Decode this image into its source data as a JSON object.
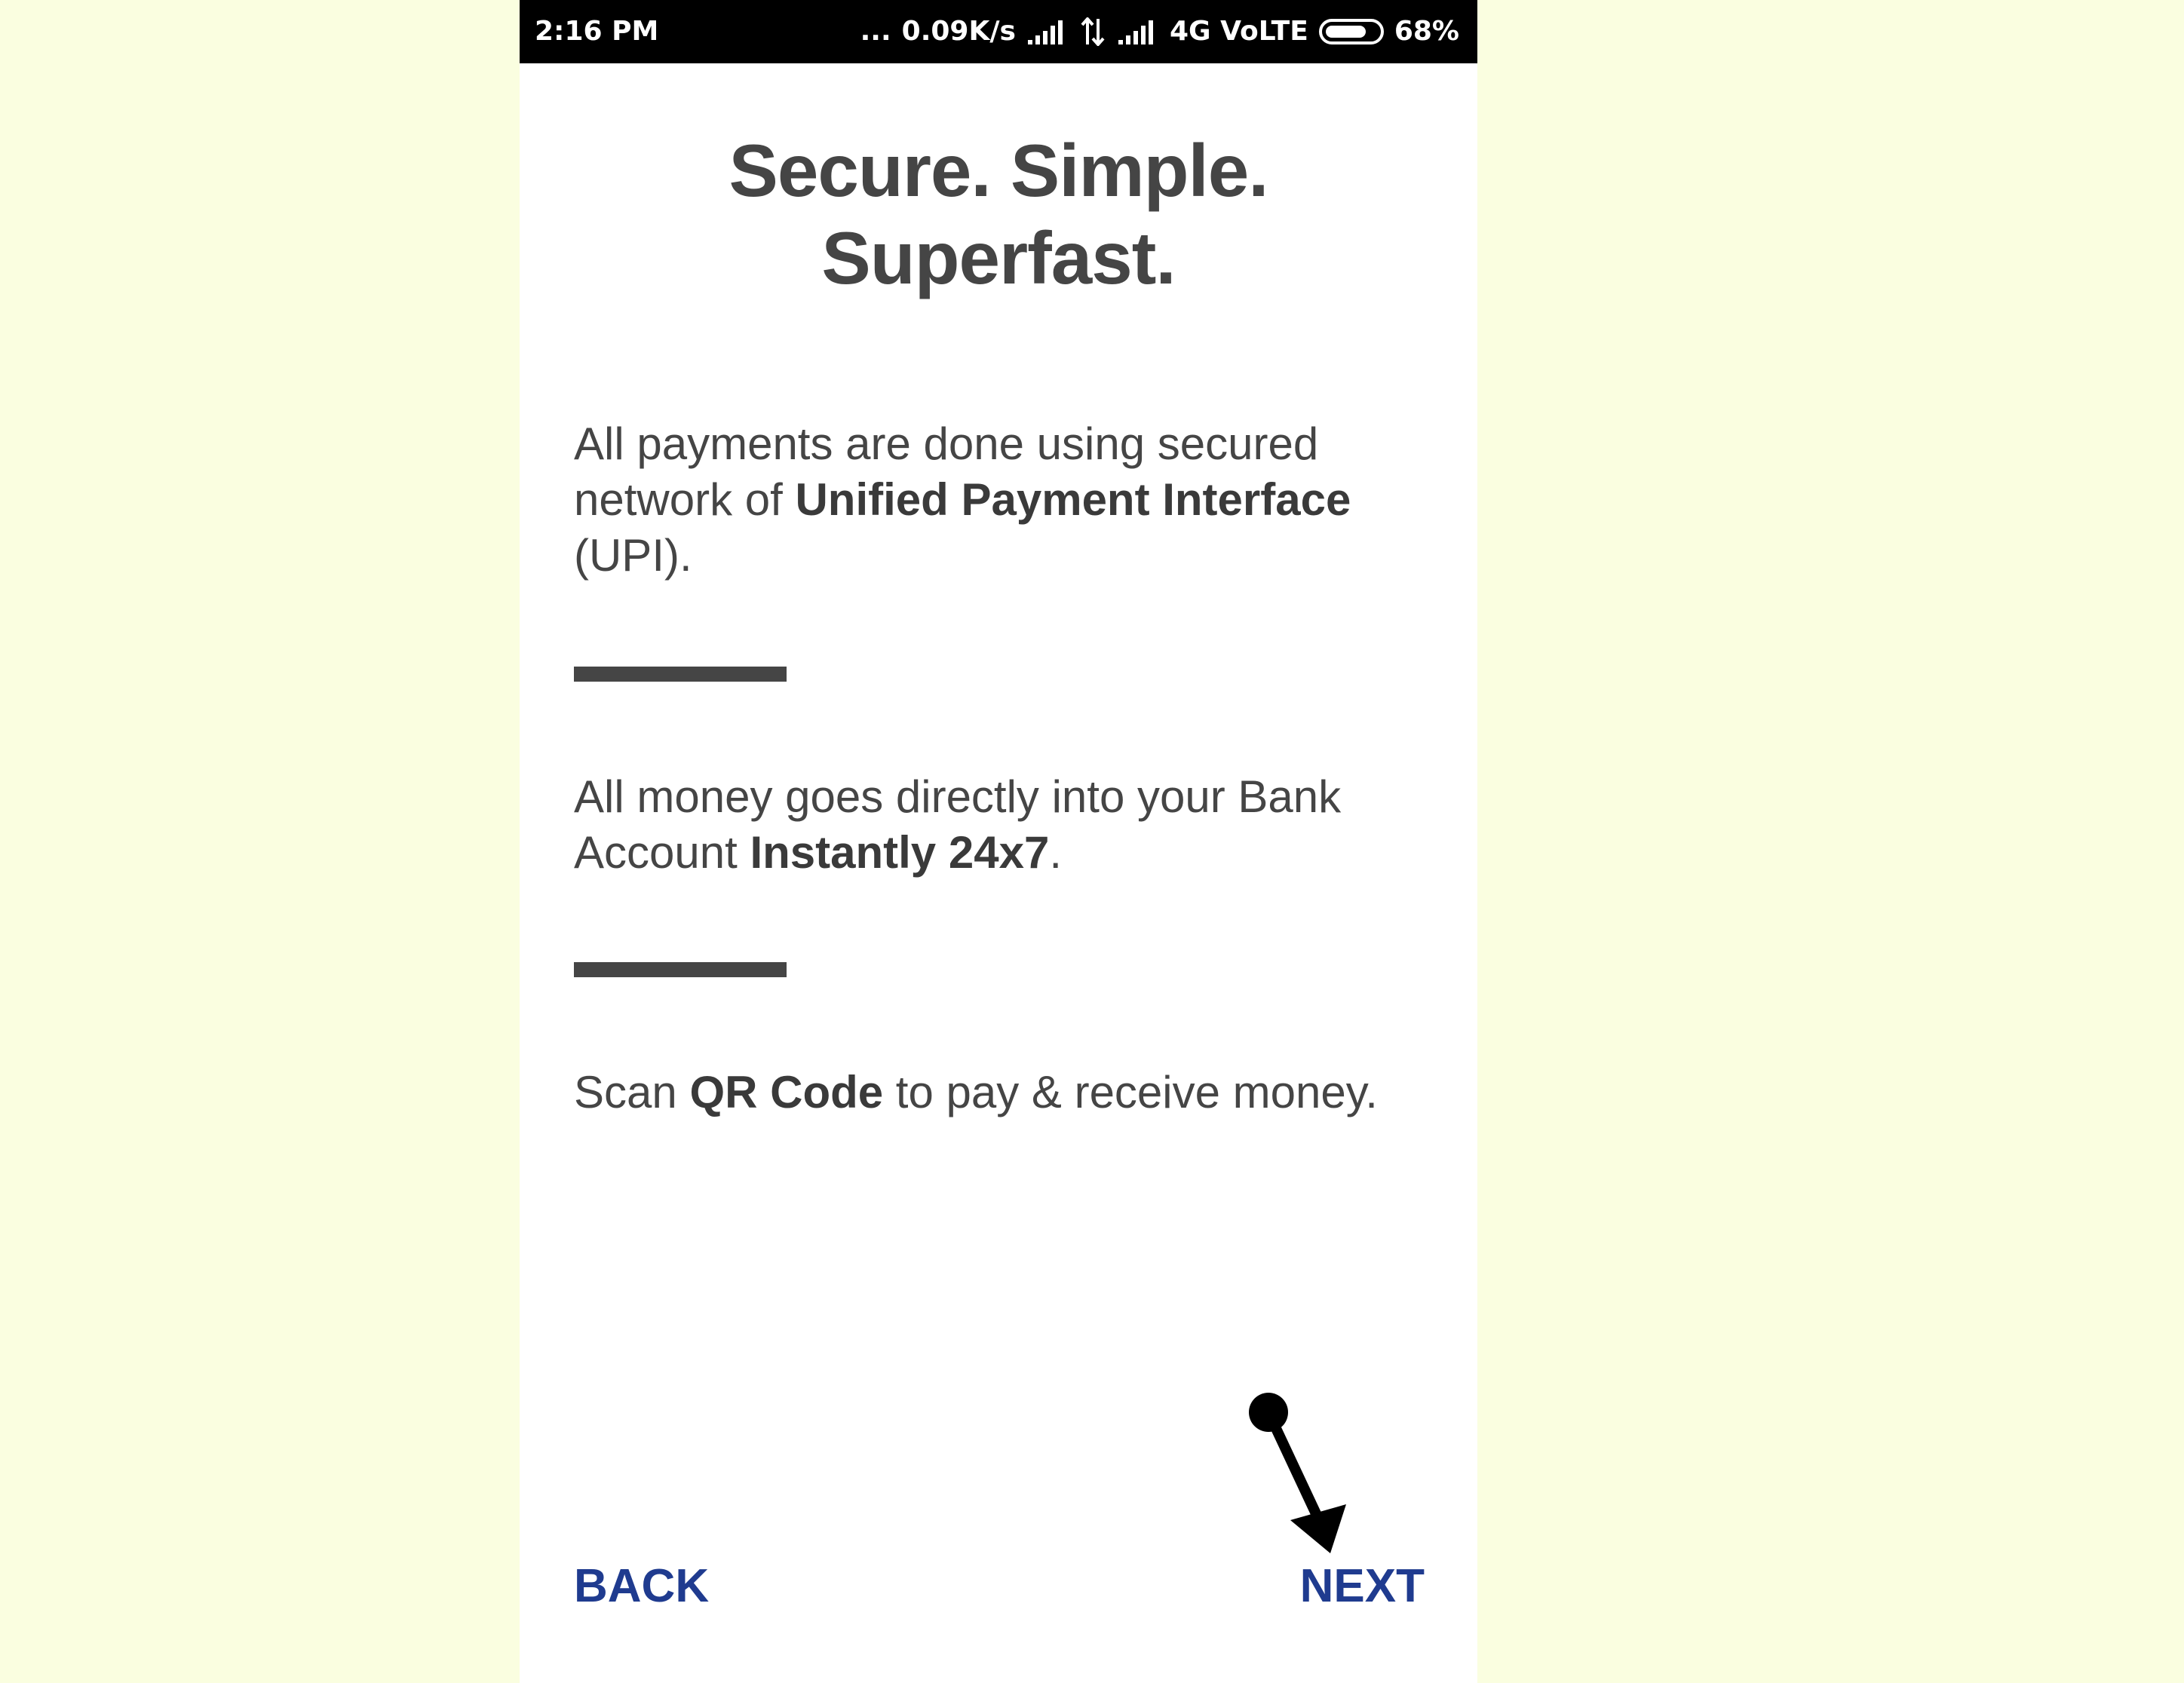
{
  "status_bar": {
    "time": "2:16 PM",
    "dots": "...",
    "network_speed": "0.09K/s",
    "network_type": "4G VoLTE",
    "battery": "68%"
  },
  "onboarding": {
    "title_line1": "Secure. Simple.",
    "title_line2": "Superfast.",
    "point1": {
      "pre": "All payments are done using secured network of ",
      "bold": "Unified Payment Interface",
      "post": " (UPI)."
    },
    "point2": {
      "pre": "All money goes directly into your Bank Account ",
      "bold": "Instantly 24x7",
      "post": "."
    },
    "point3": {
      "pre": "Scan ",
      "bold": "QR Code",
      "post": " to pay & receive money."
    }
  },
  "navigation": {
    "back_label": "BACK",
    "next_label": "NEXT"
  },
  "colors": {
    "page_background": "#fafee0",
    "accent": "#1f3b8f",
    "text": "#454545"
  }
}
